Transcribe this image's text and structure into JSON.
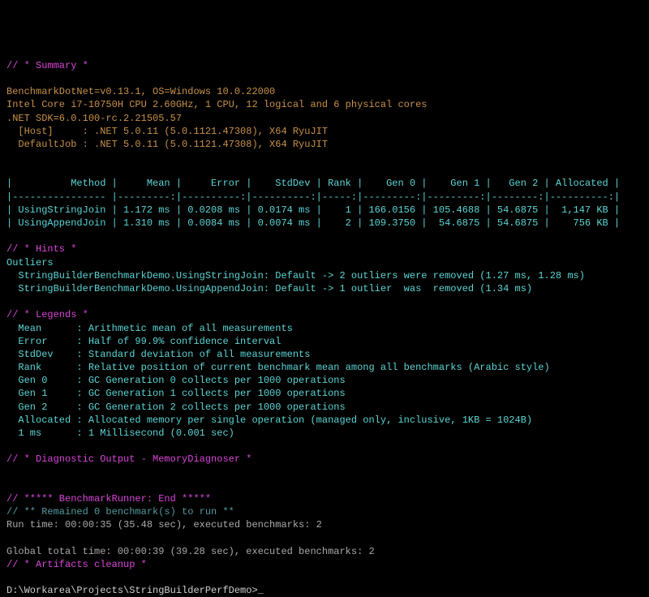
{
  "summary_header": "// * Summary *",
  "env_line1": "BenchmarkDotNet=v0.13.1, OS=Windows 10.0.22000",
  "env_line2": "Intel Core i7-10750H CPU 2.60GHz, 1 CPU, 12 logical and 6 physical cores",
  "env_line3": ".NET SDK=6.0.100-rc.2.21505.57",
  "env_line4": "  [Host]     : .NET 5.0.11 (5.0.1121.47308), X64 RyuJIT",
  "env_line5": "  DefaultJob : .NET 5.0.11 (5.0.1121.47308), X64 RyuJIT",
  "table_header": "|          Method |     Mean |     Error |    StdDev | Rank |    Gen 0 |    Gen 1 |   Gen 2 | Allocated |",
  "table_sep": "|---------------- |---------:|----------:|----------:|-----:|---------:|---------:|--------:|----------:|",
  "table_row1": "| UsingStringJoin | 1.172 ms | 0.0208 ms | 0.0174 ms |    1 | 166.0156 | 105.4688 | 54.6875 |  1,147 KB |",
  "table_row2": "| UsingAppendJoin | 1.310 ms | 0.0084 ms | 0.0074 ms |    2 | 109.3750 |  54.6875 | 54.6875 |    756 KB |",
  "hints_header": "// * Hints *",
  "hints_outliers": "Outliers",
  "hints_line1": "  StringBuilderBenchmarkDemo.UsingStringJoin: Default -> 2 outliers were removed (1.27 ms, 1.28 ms)",
  "hints_line2": "  StringBuilderBenchmarkDemo.UsingAppendJoin: Default -> 1 outlier  was  removed (1.34 ms)",
  "legends_header": "// * Legends *",
  "legend1": "  Mean      : Arithmetic mean of all measurements",
  "legend2": "  Error     : Half of 99.9% confidence interval",
  "legend3": "  StdDev    : Standard deviation of all measurements",
  "legend4": "  Rank      : Relative position of current benchmark mean among all benchmarks (Arabic style)",
  "legend5": "  Gen 0     : GC Generation 0 collects per 1000 operations",
  "legend6": "  Gen 1     : GC Generation 1 collects per 1000 operations",
  "legend7": "  Gen 2     : GC Generation 2 collects per 1000 operations",
  "legend8": "  Allocated : Allocated memory per single operation (managed only, inclusive, 1KB = 1024B)",
  "legend9": "  1 ms      : 1 Millisecond (0.001 sec)",
  "diag_header": "// * Diagnostic Output - MemoryDiagnoser *",
  "runner_end": "// ***** BenchmarkRunner: End *****",
  "remained": "// ** Remained 0 benchmark(s) to run **",
  "runtime": "Run time: 00:00:35 (35.48 sec), executed benchmarks: 2",
  "global_total": "Global total time: 00:00:39 (39.28 sec), executed benchmarks: 2",
  "artifacts": "// * Artifacts cleanup *",
  "prompt": "D:\\Workarea\\Projects\\StringBuilderPerfDemo>",
  "cursor": "_"
}
